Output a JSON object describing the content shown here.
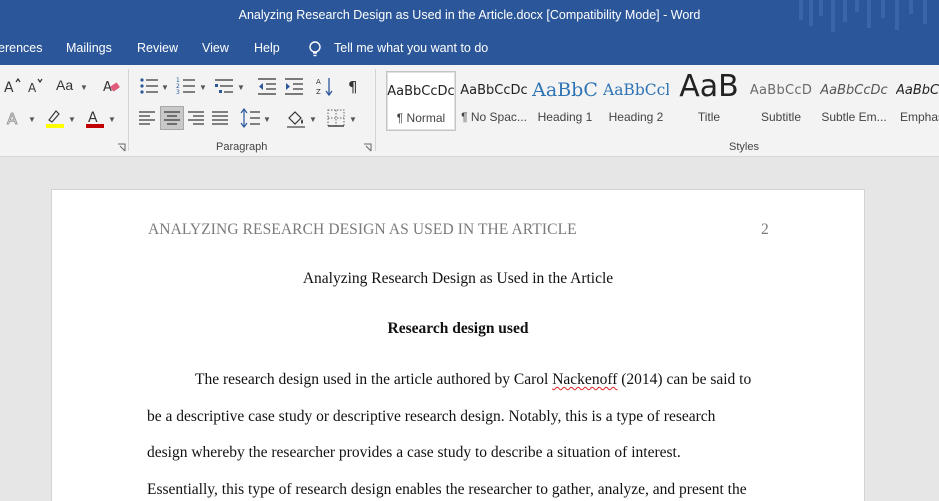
{
  "window": {
    "title": "Analyzing Research Design as Used in the Article.docx [Compatibility Mode]  -  Word"
  },
  "tabs": [
    {
      "label": "erences"
    },
    {
      "label": "Mailings"
    },
    {
      "label": "Review"
    },
    {
      "label": "View"
    },
    {
      "label": "Help"
    }
  ],
  "tell_me": "Tell me what you want to do",
  "ribbon": {
    "paragraph_label": "Paragraph",
    "styles_label": "Styles",
    "change_case_label": "Aa",
    "colors": {
      "highlight": "#ffff00",
      "font_color": "#c00000",
      "accent": "#2b579a"
    },
    "styles": [
      {
        "sample": "AaBbCcDc",
        "name": "¶ Normal"
      },
      {
        "sample": "AaBbCcDc",
        "name": "¶ No Spac..."
      },
      {
        "sample": "AaBbC",
        "name": "Heading 1"
      },
      {
        "sample": "AaBbCcl",
        "name": "Heading 2"
      },
      {
        "sample": "AaB",
        "name": "Title"
      },
      {
        "sample": "AaBbCcD",
        "name": "Subtitle"
      },
      {
        "sample": "AaBbCcDc",
        "name": "Subtle Em..."
      },
      {
        "sample": "AaBbCc",
        "name": "Emphas"
      }
    ]
  },
  "document": {
    "running_head": "ANALYZING RESEARCH DESIGN AS USED IN THE ARTICLE",
    "page_number": "2",
    "title": "Analyzing Research Design as Used in the Article",
    "heading": "Research design used",
    "lines": [
      {
        "before": "The research design used in the article authored by Carol ",
        "flag": "Nackenoff",
        "after": " (2014) can be said to"
      },
      {
        "text": "be a descriptive case study or descriptive research design. Notably, this is a type of research"
      },
      {
        "text": "design whereby the researcher provides a case study to describe a situation of interest."
      },
      {
        "text": "Essentially, this type of research design enables the researcher to gather, analyze, and present the"
      }
    ]
  }
}
